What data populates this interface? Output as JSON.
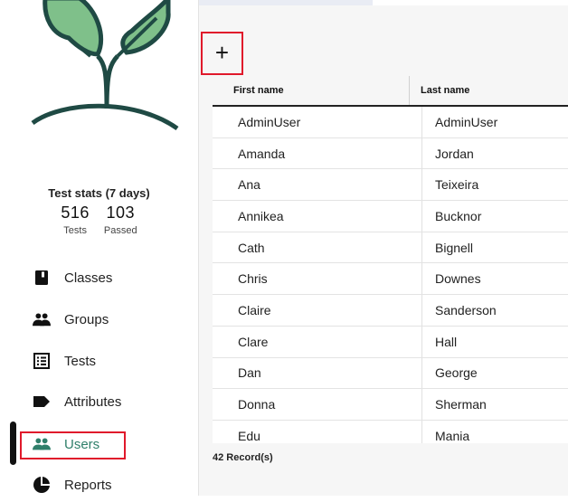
{
  "colors": {
    "accent": "#e0192b",
    "leaf_fill": "#7fc08a",
    "leaf_stroke": "#1f4a44"
  },
  "stats": {
    "title": "Test stats (7 days)",
    "tests_value": "516",
    "tests_label": "Tests",
    "passed_value": "103",
    "passed_label": "Passed"
  },
  "nav": {
    "items": [
      {
        "label": "Classes",
        "icon": "book-icon"
      },
      {
        "label": "Groups",
        "icon": "people-icon"
      },
      {
        "label": "Tests",
        "icon": "checklist-icon"
      },
      {
        "label": "Attributes",
        "icon": "tag-icon"
      },
      {
        "label": "Users",
        "icon": "users-icon",
        "active": true
      },
      {
        "label": "Reports",
        "icon": "pie-chart-icon"
      }
    ]
  },
  "toolbar": {
    "add_label": "+"
  },
  "table": {
    "headers": [
      "First name",
      "Last name"
    ],
    "rows": [
      [
        "AdminUser",
        "AdminUser"
      ],
      [
        "Amanda",
        "Jordan"
      ],
      [
        "Ana",
        "Teixeira"
      ],
      [
        "Annikea",
        "Bucknor"
      ],
      [
        "Cath",
        "Bignell"
      ],
      [
        "Chris",
        "Downes"
      ],
      [
        "Claire",
        "Sanderson"
      ],
      [
        "Clare",
        "Hall"
      ],
      [
        "Dan",
        "George"
      ],
      [
        "Donna",
        "Sherman"
      ],
      [
        "Edu",
        "Mania"
      ]
    ]
  },
  "records_label": "42 Record(s)"
}
